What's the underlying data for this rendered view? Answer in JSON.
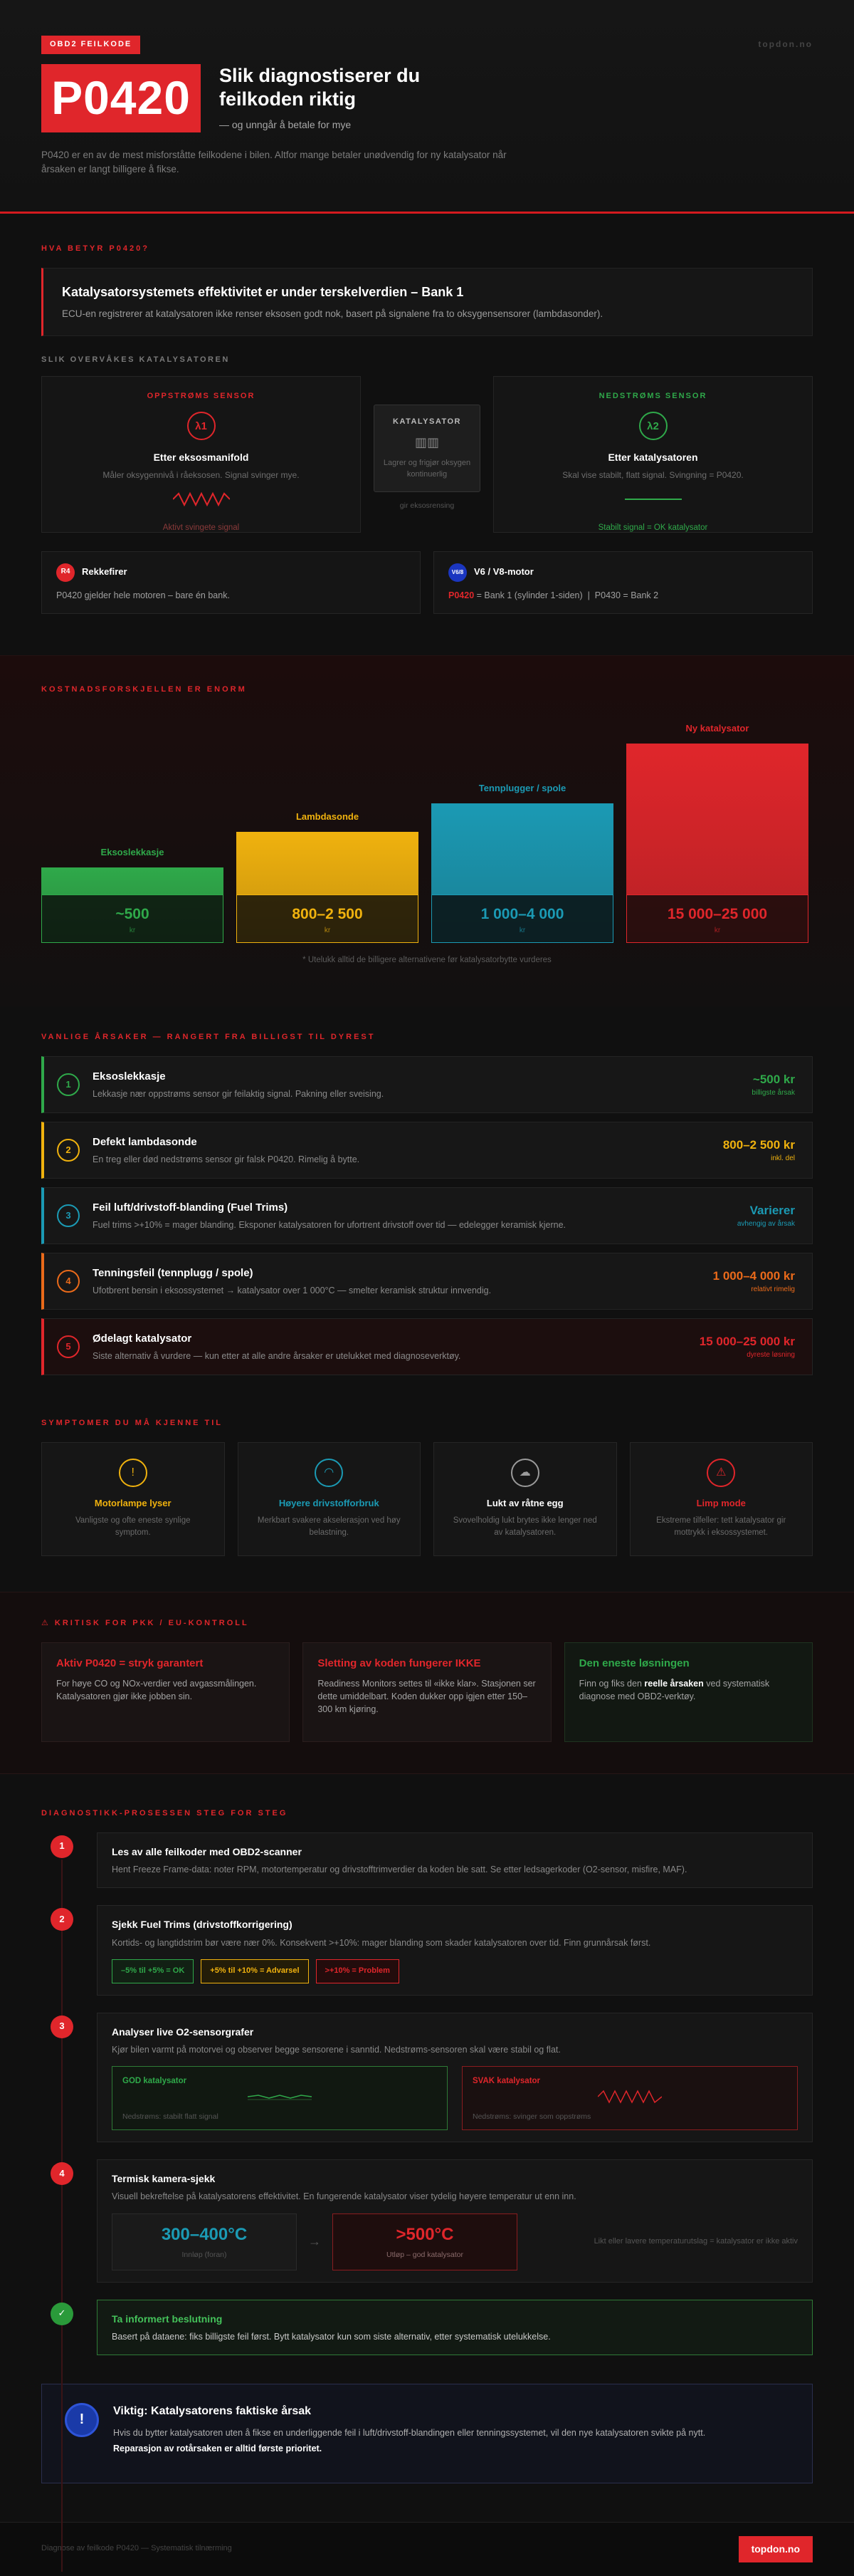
{
  "hero": {
    "badge": "OBD2 FEILKODE",
    "brand": "topdon.no",
    "code": "P0420",
    "title": "Slik diagnostiserer du feilkoden riktig",
    "subtitle": "— og unngår å betale for mye",
    "desc": "P0420 er en av de mest misforståtte feilkodene i bilen. Altfor mange betaler unødvendig for ny katalysator når årsaken er langt billigere å fikse."
  },
  "meaning": {
    "label": "HVA BETYR P0420?",
    "title": "Katalysatorsystemets effektivitet er under terskelverdien – Bank 1",
    "desc": "ECU-en registrerer at katalysatoren ikke renser eksosen godt nok, basert på signalene fra to oksygensensorer (lambdasonder).",
    "monitor_label": "SLIK OVERVÅKES KATALYSATOREN",
    "upstream": {
      "label": "OPPSTRØMS SENSOR",
      "symbol": "λ1",
      "title": "Etter eksosmanifold",
      "desc": "Måler oksygennivå i råeksosen. Signal svinger mye.",
      "note": "Aktivt svingete signal",
      "color": "#e0262b"
    },
    "catalyst": {
      "label": "KATALYSATOR",
      "icon": "catalyst-icon",
      "desc": "Lagrer og frigjør oksygen kontinuerlig",
      "flow": "gir eksosrensing"
    },
    "downstream": {
      "label": "NEDSTRØMS SENSOR",
      "symbol": "λ2",
      "title": "Etter katalysatoren",
      "desc": "Skal vise stabilt, flatt signal. Svingning = P0420.",
      "note": "Stabilt signal = OK katalysator",
      "color": "#2fa94a"
    },
    "engines": [
      {
        "tag": "R4",
        "title": "Rekkefirer",
        "desc": "P0420 gjelder hele motoren – bare én bank.",
        "color": "#e0262b"
      },
      {
        "tag": "V6/8",
        "title": "V6 / V8-motor",
        "desc_code": "P0420",
        "desc": " = Bank 1 (sylinder 1-siden)  |  P0430 = Bank 2",
        "color": "#1b36c0"
      }
    ]
  },
  "cost": {
    "label": "KOSTNADSFORSKJELLEN ER ENORM",
    "bars": [
      {
        "name": "Eksoslekkasje",
        "value": "~500",
        "unit": "kr",
        "fraction": 0.13,
        "color": "#2fa94a"
      },
      {
        "name": "Lambdasonde",
        "value": "800–2 500",
        "unit": "kr",
        "fraction": 0.38,
        "color": "#f0b20e"
      },
      {
        "name": "Tennplugger / spole",
        "value": "1 000–4 000",
        "unit": "kr",
        "fraction": 0.58,
        "color": "#1b9ab4"
      },
      {
        "name": "Ny katalysator",
        "value": "15 000–25 000",
        "unit": "kr",
        "fraction": 1.0,
        "color": "#e0262b"
      }
    ],
    "footnote": "* Utelukk alltid de billigere alternativene før katalysatorbytte vurderes"
  },
  "causes": {
    "label": "VANLIGE ÅRSAKER — RANGERT FRA BILLIGST TIL DYREST",
    "items": [
      {
        "num": "1",
        "title": "Eksoslekkasje",
        "desc": "Lekkasje nær oppstrøms sensor gir feilaktig signal. Pakning eller sveising.",
        "price": "~500 kr",
        "note": "billigste årsak",
        "color": "#2fa94a"
      },
      {
        "num": "2",
        "title": "Defekt lambdasonde",
        "desc": "En treg eller død nedstrøms sensor gir falsk P0420. Rimelig å bytte.",
        "price": "800–2 500 kr",
        "note": "inkl. del",
        "color": "#f0b20e"
      },
      {
        "num": "3",
        "title": "Feil luft/drivstoff-blanding (Fuel Trims)",
        "desc": "Fuel trims >+10% = mager blanding. Eksponer katalysatoren for ufortrent drivstoff over tid — edelegger keramisk kjerne.",
        "price": "Varierer",
        "note": "avhengig av årsak",
        "color": "#1b9ab4"
      },
      {
        "num": "4",
        "title": "Tenningsfeil (tennplugg / spole)",
        "desc": "Ufotbrent bensin i eksossystemet → katalysator over 1 000°C — smelter keramisk struktur innvendig.",
        "price": "1 000–4 000 kr",
        "note": "relativt rimelig",
        "color": "#ea6a1a"
      },
      {
        "num": "5",
        "title": "Ødelagt katalysator",
        "desc": "Siste alternativ å vurdere — kun etter at alle andre årsaker er utelukket med diagnoseverktøy.",
        "price": "15 000–25 000 kr",
        "note": "dyreste løsning",
        "color": "#e0262b"
      }
    ]
  },
  "symptoms": {
    "label": "SYMPTOMER DU MÅ KJENNE TIL",
    "items": [
      {
        "icon": "warning-icon",
        "glyph": "!",
        "title": "Motorlampe lyser",
        "desc": "Vanligste og ofte eneste synlige symptom.",
        "color": "#f0b20e"
      },
      {
        "icon": "gauge-icon",
        "glyph": "◠",
        "title": "Høyere drivstofforbruk",
        "desc": "Merkbart svakere akselerasjon ved høy belastning.",
        "color": "#1b9ab4"
      },
      {
        "icon": "smell-icon",
        "glyph": "☁",
        "title": "Lukt av råtne egg",
        "desc": "Svovelholdig lukt brytes ikke lenger ned av katalysatoren.",
        "color": "#9a9a9a"
      },
      {
        "icon": "limp-icon",
        "glyph": "⚠",
        "title": "Limp mode",
        "desc": "Ekstreme tilfeller: tett katalysator gir mottrykk i eksossystemet.",
        "color": "#e0262b"
      }
    ]
  },
  "eu": {
    "label": "⚠ KRITISK FOR PKK / EU-KONTROLL",
    "items": [
      {
        "title": "Aktiv P0420 = stryk garantert",
        "desc": "For høye CO og NOx-verdier ved avgassmålingen. Katalysatoren gjør ikke jobben sin.",
        "color": "#e0262b"
      },
      {
        "title": "Sletting av koden fungerer IKKE",
        "desc": "Readiness Monitors settes til «ikke klar». Stasjonen ser dette umiddelbart. Koden dukker opp igjen etter 150–300 km kjøring.",
        "color": "#e0262b"
      },
      {
        "title": "Den eneste løsningen",
        "desc_a": "Finn og fiks den ",
        "desc_b": "reelle årsaken",
        "desc_c": " ved systematisk diagnose med OBD2-verktøy.",
        "color": "#2fa94a"
      }
    ]
  },
  "steps": {
    "label": "DIAGNOSTIKK-PROSESSEN STEG FOR STEG",
    "s1": {
      "num": "1",
      "title": "Les av alle feilkoder med OBD2-scanner",
      "desc": "Hent Freeze Frame-data: noter RPM, motortemperatur og drivstofftrimverdier da koden ble satt. Se etter ledsagerkoder (O2-sensor, misfire, MAF)."
    },
    "s2": {
      "num": "2",
      "title": "Sjekk Fuel Trims (drivstoffkorrigering)",
      "desc": "Kortids- og langtidstrim bør være nær 0%. Konsekvent >+10%: mager blanding som skader katalysatoren over tid. Finn grunnårsak først.",
      "trims": [
        {
          "text": "–5% til +5% = OK",
          "color": "#2fa94a"
        },
        {
          "text": "+5% til +10% = Advarsel",
          "color": "#f0b20e"
        },
        {
          "text": ">+10% = Problem",
          "color": "#e0262b"
        }
      ]
    },
    "s3": {
      "num": "3",
      "title": "Analyser live O2-sensorgrafer",
      "desc": "Kjør bilen varmt på motorvei og observer begge sensorene i sanntid. Nedstrøms-sensoren skal være stabil og flat.",
      "good": {
        "title": "GOD katalysator",
        "desc": "Nedstrøms: stabilt flatt signal"
      },
      "bad": {
        "title": "SVAK katalysator",
        "desc": "Nedstrøms: svinger som oppstrøms"
      }
    },
    "s4": {
      "num": "4",
      "title": "Termisk kamera-sjekk",
      "desc": "Visuell bekreftelse på katalysatorens effektivitet. En fungerende katalysator viser tydelig høyere temperatur ut enn inn.",
      "inlet": {
        "value": "300–400°C",
        "label": "Innløp (foran)"
      },
      "outlet": {
        "value": ">500°C",
        "label": "Utløp – god katalysator"
      },
      "note": "Likt eller lavere temperaturutslag = katalysator er ikke aktiv"
    },
    "final": {
      "glyph": "✓",
      "title": "Ta informert beslutning",
      "desc": "Basert på dataene: fiks billigste feil først. Bytt katalysator kun som siste alternativ, etter systematisk utelukkelse."
    }
  },
  "important": {
    "glyph": "!",
    "title": "Viktig: Katalysatorens faktiske årsak",
    "desc": "Hvis du bytter katalysatoren uten å fikse en underliggende feil i luft/drivstoff-blandingen eller tenningssystemet, vil den nye katalysatoren svikte på nytt.",
    "bold": "Reparasjon av rotårsaken er alltid første prioritet."
  },
  "footer": {
    "text": "Diagnose av feilkode P0420 — Systematisk tilnærming",
    "brand": "topdon.no"
  }
}
